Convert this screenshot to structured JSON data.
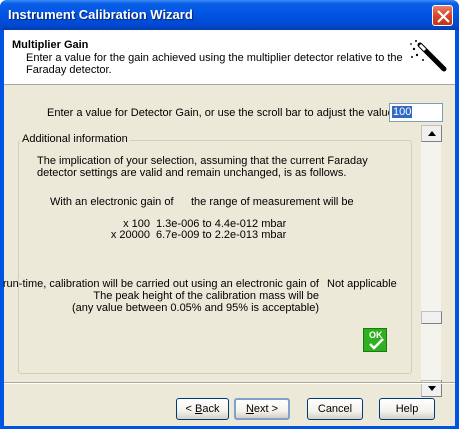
{
  "window": {
    "title": "Instrument Calibration Wizard"
  },
  "header": {
    "title": "Multiplier Gain",
    "subtitle": "Enter a value for the gain achieved using the multiplier detector relative to the Faraday detector."
  },
  "prompt": "Enter a value for Detector Gain, or use the scroll bar to adjust the value.",
  "detector_gain": {
    "value": "100"
  },
  "additional_info": {
    "legend": "Additional information",
    "paragraph": "The implication of your selection, assuming that the current Faraday detector settings are valid and remain unchanged, is as follows.",
    "col1_header": "With an electronic gain of",
    "col2_header": "the range of measurement will be",
    "rows": [
      {
        "gain": "x 100",
        "range": "1.3e-006 to 4.4e-012 mbar"
      },
      {
        "gain": "x 20000",
        "range": "6.7e-009 to 2.2e-013 mbar"
      }
    ],
    "runtime_line1": "At run-time, calibration will be carried out using an electronic gain of",
    "runtime_value": "Not applicable",
    "runtime_line2": "The peak height of the calibration mass will be",
    "runtime_line3": "(any value between 0.05% and 95% is acceptable)",
    "ok_label": "OK"
  },
  "scrollbar": {
    "position": 0.75
  },
  "buttons": {
    "back": {
      "mnemonic": "B",
      "rest": "ack",
      "prefix": "< "
    },
    "next": {
      "mnemonic": "N",
      "rest": "ext >"
    },
    "cancel": "Cancel",
    "help": "Help"
  },
  "colors": {
    "title_bar": "#0054e3",
    "dialog_bg": "#ece9d8",
    "ok_green": "#30b020",
    "selection": "#316ac5"
  }
}
